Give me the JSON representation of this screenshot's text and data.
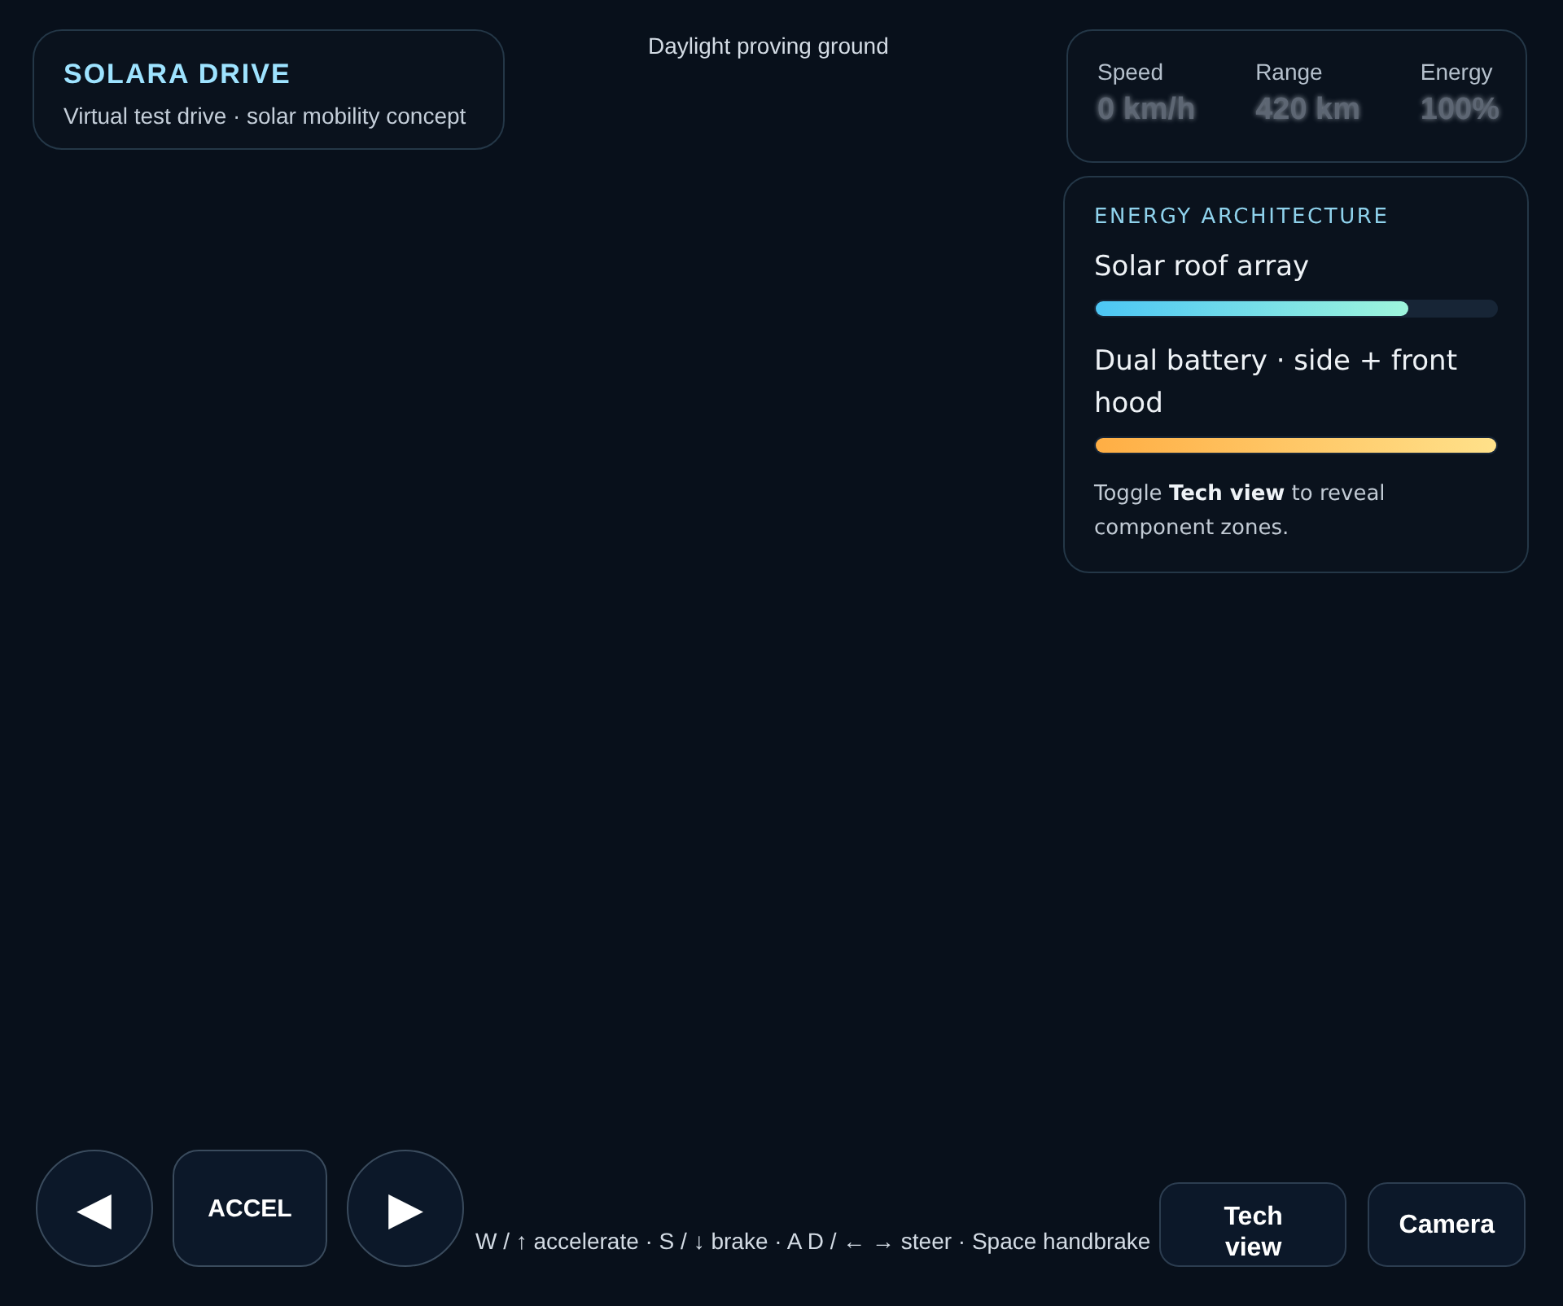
{
  "brand": {
    "title": "SOLARA DRIVE",
    "subtitle": "Virtual test drive · solar mobility concept"
  },
  "scene_label": "Daylight proving ground",
  "stats": [
    {
      "label": "Speed",
      "value": "0 km/h"
    },
    {
      "label": "Range",
      "value": "420 km"
    },
    {
      "label": "Energy",
      "value": "100%"
    }
  ],
  "energy": {
    "heading": "ENERGY ARCHITECTURE",
    "items": [
      {
        "label": "Solar roof array",
        "level": 0.78,
        "kind": "solar"
      },
      {
        "label": "Dual battery · side + front hood",
        "level": 1.0,
        "kind": "battery"
      }
    ],
    "note": "Toggle **Tech view** to reveal component zones."
  },
  "controls": [
    {
      "kind": "left",
      "label": "◀"
    },
    {
      "kind": "text",
      "label": "ACCEL"
    },
    {
      "kind": "right",
      "label": "▶"
    }
  ],
  "hint": "W / ↑ accelerate · S / ↓ brake · A D / ← → steer · Space handbrake",
  "buttons": [
    {
      "label": "Tech view"
    },
    {
      "label": "Camera"
    }
  ]
}
